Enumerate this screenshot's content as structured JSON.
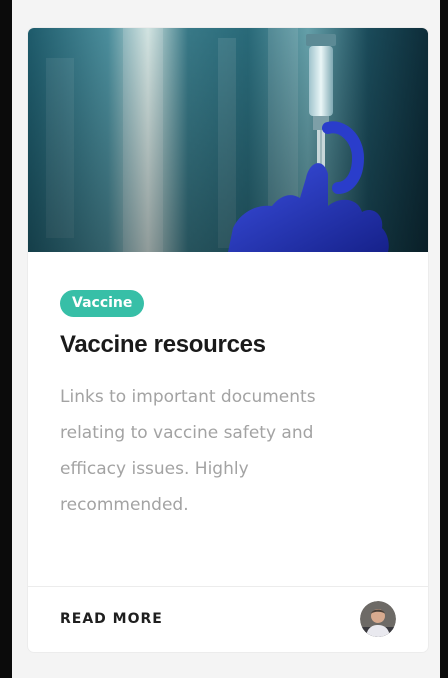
{
  "card": {
    "image_alt": "gloved hand holding vaccine syringe",
    "tag": "Vaccine",
    "title": "Vaccine resources",
    "description": "Links to important documents relating to vaccine safety and efficacy issues. Highly recommended.",
    "read_more": "READ MORE",
    "author_avatar": "author-avatar"
  },
  "colors": {
    "tag_background": "#37bfa7",
    "title": "#1a1a1a",
    "description": "#a3a3a3",
    "glove": "#1f2fa8"
  }
}
